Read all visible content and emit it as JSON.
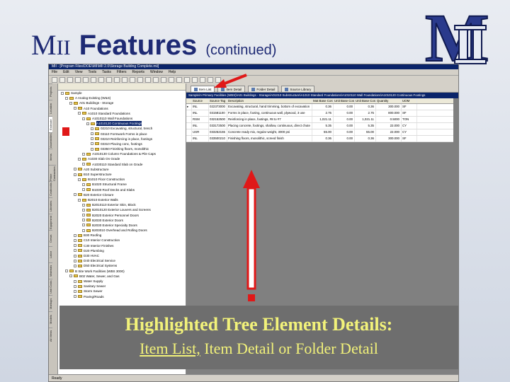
{
  "slide": {
    "title_m": "M",
    "title_ii": "II",
    "title_main": "Features",
    "title_sub": "(continued)",
    "logo_text": "MII"
  },
  "app": {
    "window_title": "MII - [Program Files\\DOE\\MII\\MII 2.0\\Storage Building Complete.mii]",
    "menu": [
      "File",
      "Edit",
      "View",
      "Tools",
      "Tasks",
      "Filters",
      "Reports",
      "Window",
      "Help"
    ],
    "left_tabs": [
      "Projects",
      "Location",
      "Estimate",
      "Assemblies",
      "Items",
      "Prime Contractors",
      "Costbooks",
      "Libraries",
      "Equipment",
      "Crews",
      "Labor",
      "Materials",
      "Unit Costs",
      "Markups",
      "Models",
      "All Views"
    ],
    "tree": [
      {
        "label": "Sample",
        "level": 0
      },
      {
        "label": "A Analog Existing (W&S)",
        "level": 1
      },
      {
        "label": "A01 Buildings - Storage",
        "level": 2
      },
      {
        "label": "A10 Foundations",
        "level": 3
      },
      {
        "label": "A1010 Standard Foundations",
        "level": 4
      },
      {
        "label": "A1010110 Wall Foundations",
        "level": 5
      },
      {
        "label": "A1010120 Continuous Footings",
        "level": 6,
        "selected": true
      },
      {
        "label": "02210 Excavating, structural, trench",
        "level": 7
      },
      {
        "label": "03110 Formwork Forms in place",
        "level": 7
      },
      {
        "label": "03210 Reinforcing in place, footings",
        "level": 7
      },
      {
        "label": "03310 Placing conc, footings",
        "level": 7
      },
      {
        "label": "03350 Finishing floors, monolithic",
        "level": 7
      },
      {
        "label": "A1010130 Column Foundations & Pile Caps",
        "level": 5
      },
      {
        "label": "A1030 Slab On Grade",
        "level": 4
      },
      {
        "label": "A1030110 Standard Slab on Grade",
        "level": 5
      },
      {
        "label": "A20 Substructure",
        "level": 3
      },
      {
        "label": "B10 Superstructure",
        "level": 3
      },
      {
        "label": "B1010 Floor Construction",
        "level": 4
      },
      {
        "label": "B1020 Structural Frame",
        "level": 5
      },
      {
        "label": "B1030 Roof Decks and Slabs",
        "level": 5
      },
      {
        "label": "B20 Exterior Closure",
        "level": 3
      },
      {
        "label": "B2010 Exterior Walls",
        "level": 4
      },
      {
        "label": "B2010110 Exterior Skin, Block",
        "level": 5
      },
      {
        "label": "B2010120 Exterior Louvers and Screens",
        "level": 5
      },
      {
        "label": "B2020 Exterior Personnel Doors",
        "level": 5
      },
      {
        "label": "B2030 Exterior Doors",
        "level": 5
      },
      {
        "label": "B2030 Exterior Specialty Doors",
        "level": 5
      },
      {
        "label": "B203010 Overhead and Rolling Doors",
        "level": 5
      },
      {
        "label": "B30 Roofing",
        "level": 3
      },
      {
        "label": "C10 Interior Construction",
        "level": 3
      },
      {
        "label": "C30 Interior Finishes",
        "level": 3
      },
      {
        "label": "D20 Plumbing",
        "level": 3
      },
      {
        "label": "D30 HVAC",
        "level": 3
      },
      {
        "label": "D40 Electrical Service",
        "level": 3
      },
      {
        "label": "D50 Electrical Systems",
        "level": 3
      },
      {
        "label": "B Site Work Facilities (WBS 3000)",
        "level": 1
      },
      {
        "label": "B02 Water, Sewer, and Gas",
        "level": 2
      },
      {
        "label": "Water Supply",
        "level": 3
      },
      {
        "label": "Sanitary Sewer",
        "level": 3
      },
      {
        "label": "Storm Sewer",
        "level": 3
      },
      {
        "label": "Paving/Roads",
        "level": 3
      }
    ],
    "detail_tabs": [
      "Item List",
      "Item Detail",
      "Folder Detail",
      "Source Library"
    ],
    "grid_title": "Sample\\A Primary Facilities (WBS)\\A01 Buildings - Storage\\A01010 Substructure\\A1010 Standard Foundations\\A1010110 Wall Foundations\\A1010120 Continuous Footings",
    "grid_headers": [
      "",
      "Source",
      "Source Tag",
      "Description",
      "Mat Base Cost",
      "Unit Base Cost",
      "Unit Base Cost",
      "Quantity",
      "UOM"
    ],
    "grid_rows": [
      [
        "▸",
        "INL",
        "022373000",
        "Excavating, structural, hand trimming, bottom of excavation",
        "0.36",
        "0.00",
        "0.36",
        "300.000",
        "SF"
      ],
      [
        "",
        "INL",
        "031581100",
        "Forms in place, footing, continuous wall, plywood, 3 use",
        "2.75",
        "0.00",
        "2.75",
        "800.000",
        "SF"
      ],
      [
        "",
        "RSM",
        "032152500",
        "Reinforcing in place, footings, #8 to #7",
        "1,021.11",
        "0.00",
        "1,021.11",
        "0.5000",
        "TON"
      ],
      [
        "",
        "INL",
        "033172500",
        "Placing concrete, footings, shallow, continuous, direct chute",
        "5.35",
        "0.00",
        "5.35",
        "22.000",
        "CY"
      ],
      [
        "",
        "USR",
        "033252155",
        "Concrete ready mix, regular weight, 3000 psi",
        "55.00",
        "0.00",
        "55.00",
        "22.000",
        "CY"
      ],
      [
        "",
        "INL",
        "033500210",
        "Finishing floors, monolithic, screed finish",
        "0.36",
        "0.00",
        "0.36",
        "300.000",
        "SF"
      ]
    ],
    "status": "Ready"
  },
  "caption": {
    "line1": "Highlighted Tree Element Details:",
    "line2_underlined": "Item List,",
    "line2_rest": " Item Detail or Folder Detail"
  },
  "colors": {
    "title": "#1e2a74",
    "caption_text": "#f2f27a",
    "caption_bg": "#6e6e6e",
    "arrow": "#e01818",
    "selection": "#0a246a"
  }
}
